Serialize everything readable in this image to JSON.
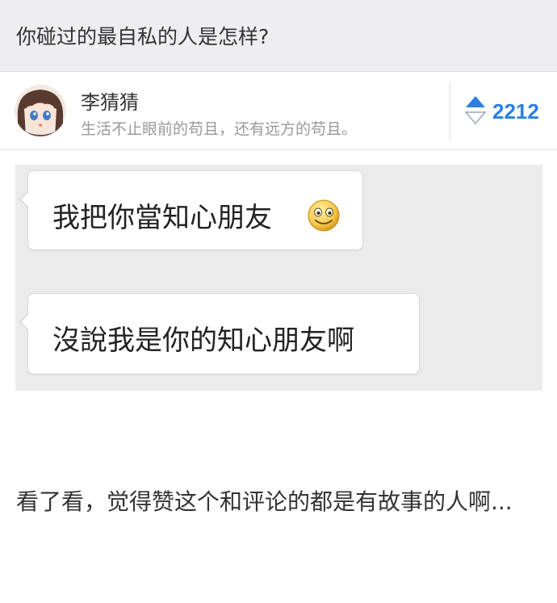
{
  "question": {
    "title": "你碰过的最自私的人是怎样?"
  },
  "author": {
    "name": "李猜猜",
    "bio": "生活不止眼前的苟且，还有远方的苟且。"
  },
  "vote": {
    "count": "2212",
    "color": "#2b7fe4"
  },
  "chat": {
    "messages": [
      {
        "text": "我把你當知心朋友",
        "emoji": "smiley-emoji"
      },
      {
        "text": "沒說我是你的知心朋友啊"
      }
    ]
  },
  "answer": {
    "text": "看了看，觉得赞这个和评论的都是有故事的人啊..."
  }
}
